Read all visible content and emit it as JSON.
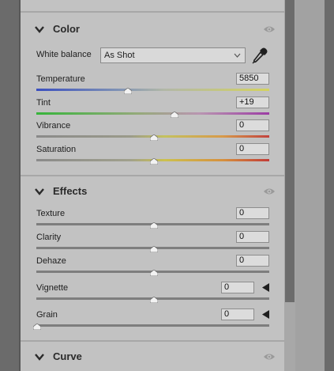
{
  "color_section": {
    "title": "Color",
    "white_balance": {
      "label": "White balance",
      "value": "As Shot"
    },
    "sliders": [
      {
        "label": "Temperature",
        "value": "5850",
        "level": 0.39
      },
      {
        "label": "Tint",
        "value": "+19",
        "level": 0.59
      },
      {
        "label": "Vibrance",
        "value": "0",
        "level": 0.5
      },
      {
        "label": "Saturation",
        "value": "0",
        "level": 0.5
      }
    ]
  },
  "effects_section": {
    "title": "Effects",
    "sliders": [
      {
        "label": "Texture",
        "value": "0",
        "level": 0.5
      },
      {
        "label": "Clarity",
        "value": "0",
        "level": 0.5
      },
      {
        "label": "Dehaze",
        "value": "0",
        "level": 0.5
      },
      {
        "label": "Vignette",
        "value": "0",
        "level": 0.5
      },
      {
        "label": "Grain",
        "value": "0",
        "level": 0.0
      }
    ]
  },
  "curve_section": {
    "title": "Curve"
  },
  "icons": {
    "collapse": "chevron-down-icon",
    "visibility": "eye-icon",
    "picker": "eyedropper-icon",
    "expand_panel": "triangle-left-icon"
  }
}
